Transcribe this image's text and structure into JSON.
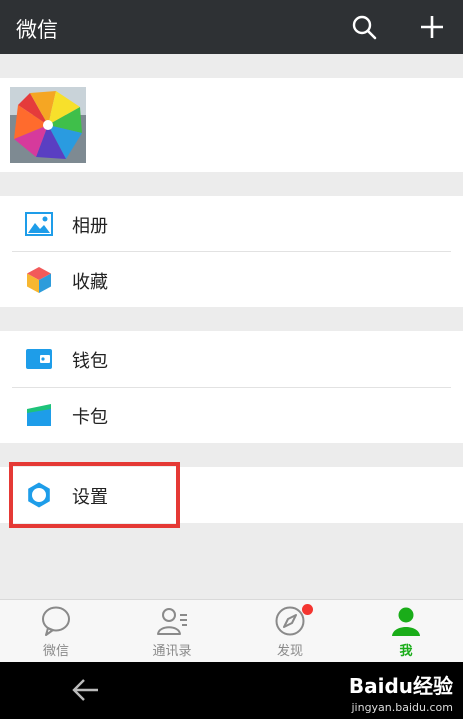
{
  "header": {
    "title": "微信",
    "search_icon": "search-icon",
    "add_icon": "plus-icon"
  },
  "menu": {
    "group1": [
      {
        "label": "相册",
        "icon": "album-icon"
      },
      {
        "label": "收藏",
        "icon": "favorites-icon"
      }
    ],
    "group2": [
      {
        "label": "钱包",
        "icon": "wallet-icon"
      },
      {
        "label": "卡包",
        "icon": "card-pack-icon"
      }
    ],
    "group3": [
      {
        "label": "设置",
        "icon": "settings-icon"
      }
    ]
  },
  "tabbar": {
    "tabs": [
      {
        "label": "微信",
        "icon": "chat-bubble-icon"
      },
      {
        "label": "通讯录",
        "icon": "contacts-icon"
      },
      {
        "label": "发现",
        "icon": "compass-icon",
        "badge": true
      },
      {
        "label": "我",
        "icon": "person-icon",
        "active": true
      }
    ]
  },
  "system_nav": {
    "back_icon": "back-arrow-icon"
  },
  "watermark": {
    "brand": "Baidu经验",
    "url": "jingyan.baidu.com"
  },
  "colors": {
    "titlebar": "#2e3134",
    "accent_green": "#1aad19",
    "icon_blue": "#1e9de9",
    "highlight_red": "#e53935",
    "badge_red": "#f43530"
  }
}
